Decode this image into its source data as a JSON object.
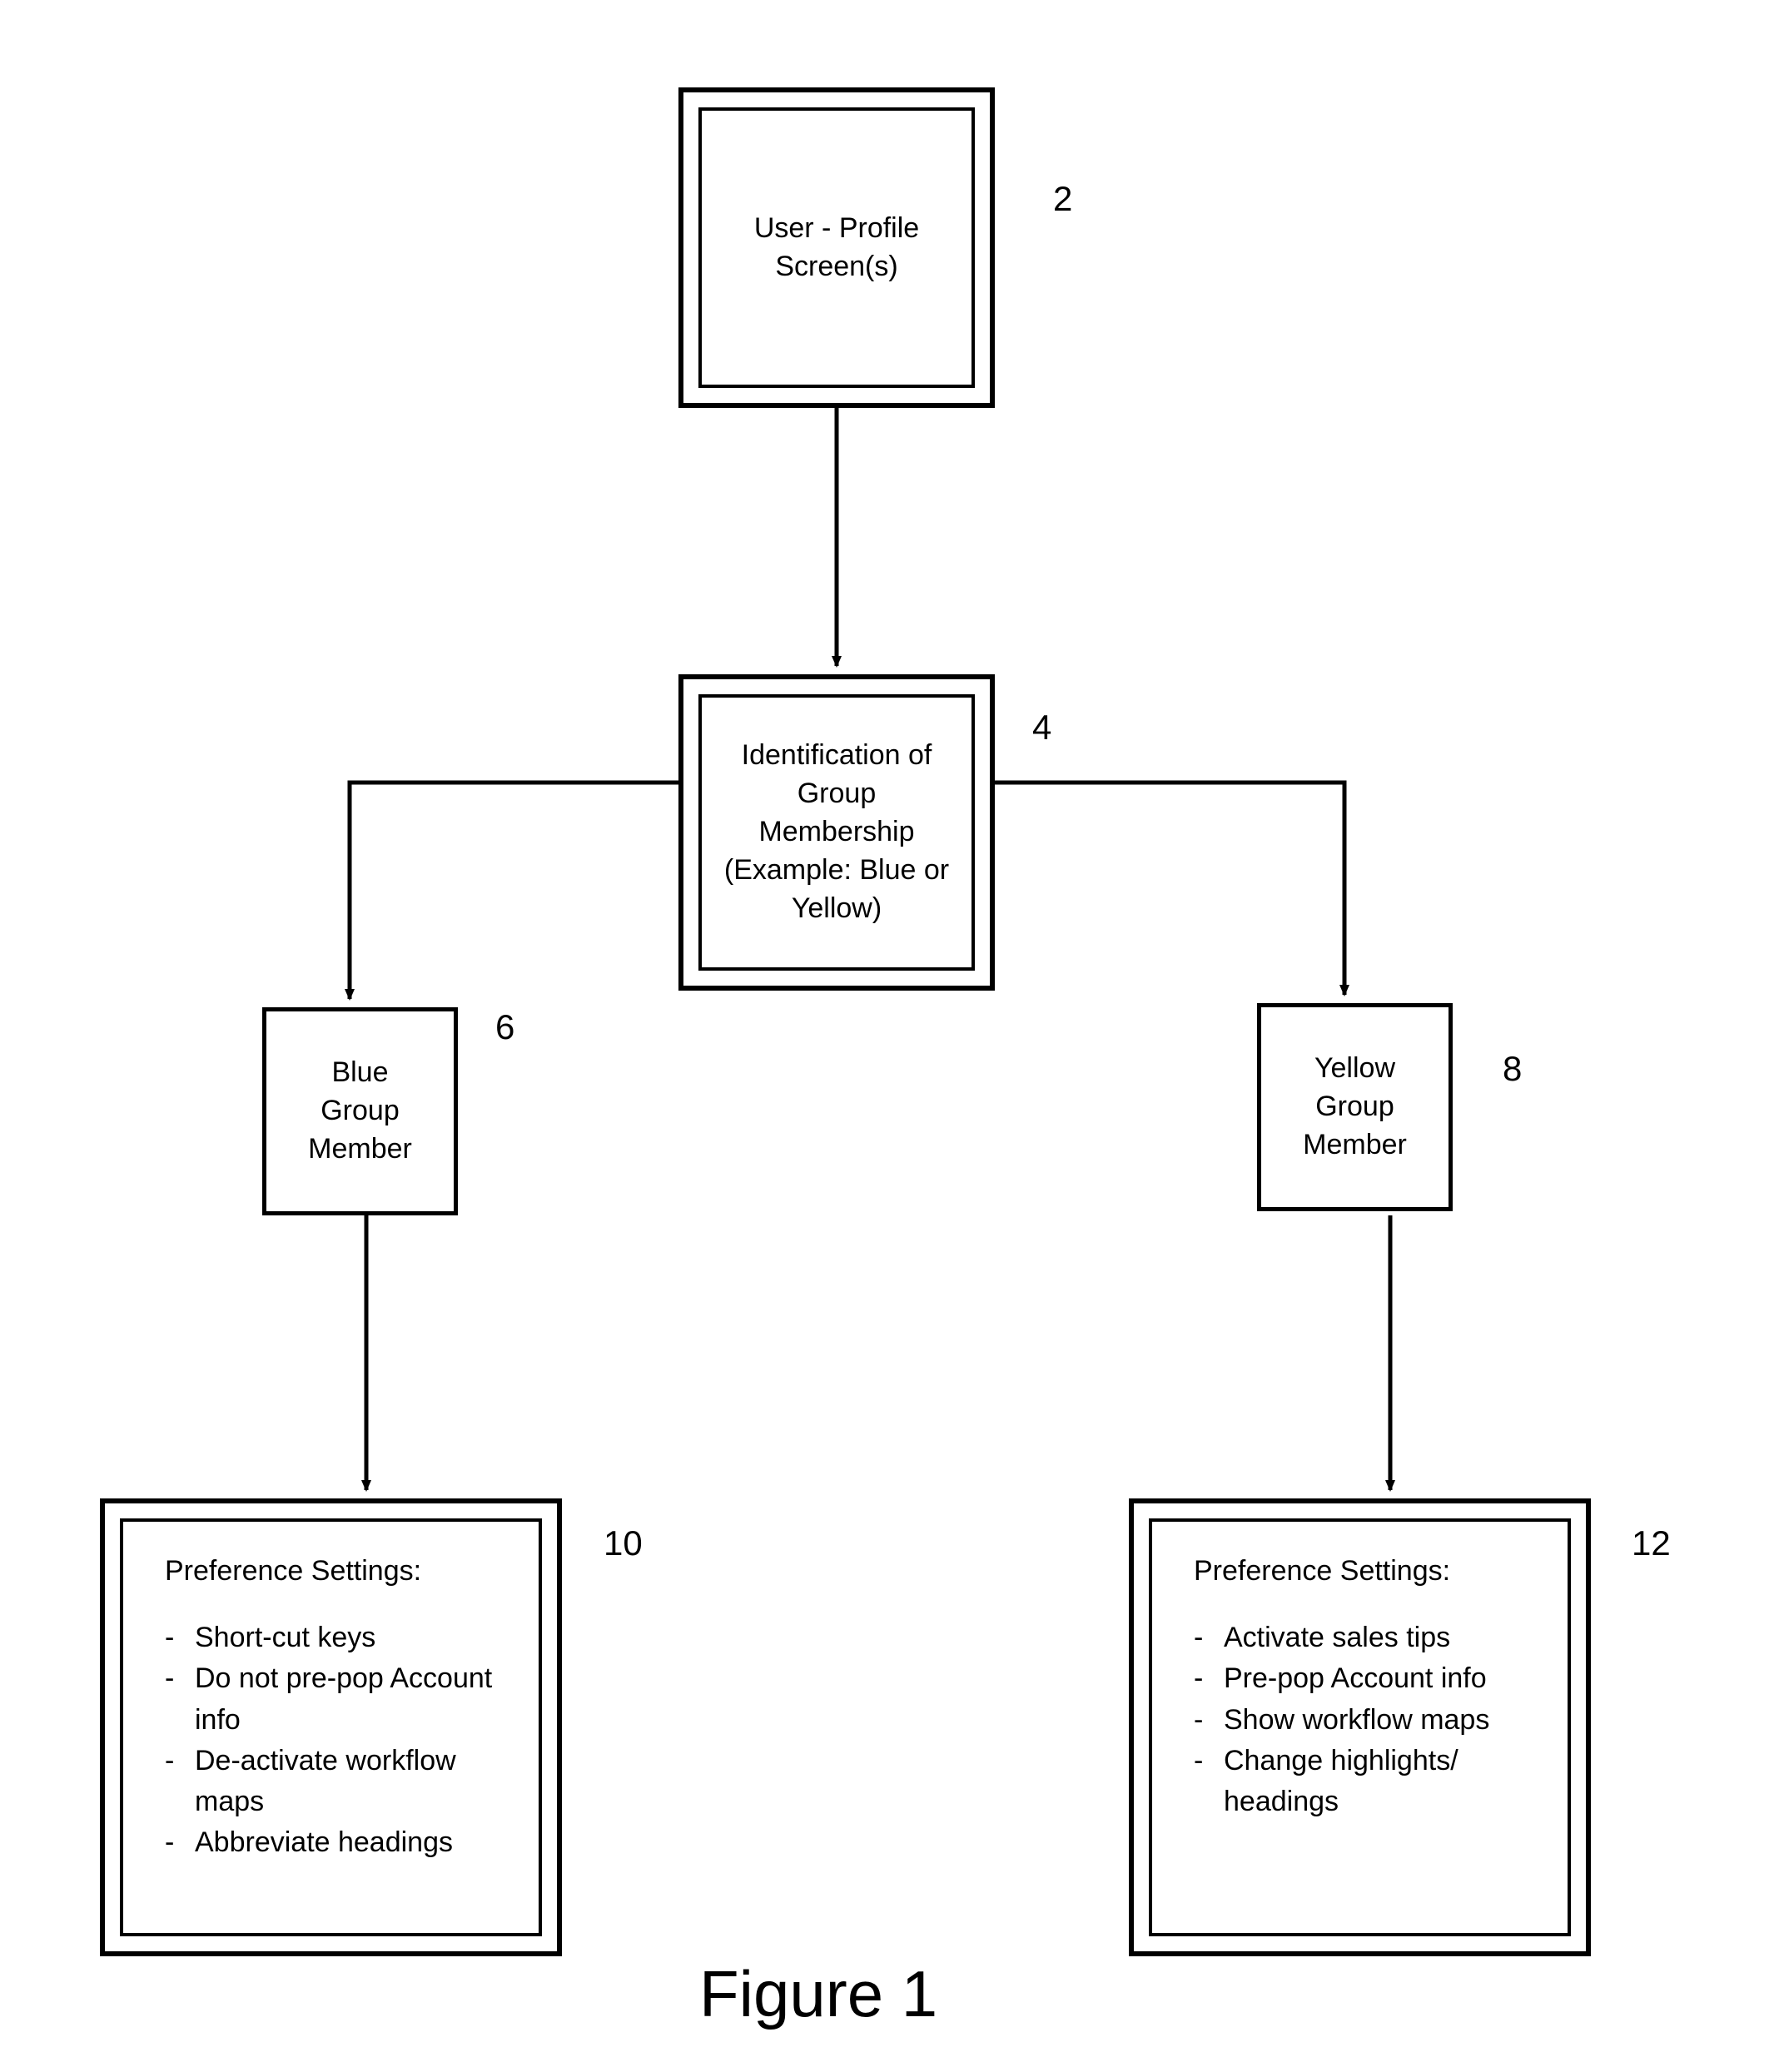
{
  "figure_title": "Figure 1",
  "nodes": {
    "n2": {
      "label": "2",
      "text": "User - Profile\nScreen(s)"
    },
    "n4": {
      "label": "4",
      "text": "Identification of\nGroup\nMembership\n(Example: Blue or\nYellow)"
    },
    "n6": {
      "label": "6",
      "text": "Blue\nGroup\nMember"
    },
    "n8": {
      "label": "8",
      "text": "Yellow\nGroup\nMember"
    },
    "n10": {
      "label": "10",
      "title": "Preference Settings:",
      "items": [
        "Short-cut keys",
        "Do not pre-pop Account info",
        "De-activate workflow maps",
        "Abbreviate headings"
      ]
    },
    "n12": {
      "label": "12",
      "title": "Preference Settings:",
      "items": [
        "Activate sales tips",
        "Pre-pop Account info",
        "Show workflow maps",
        "Change highlights/ headings"
      ]
    }
  }
}
